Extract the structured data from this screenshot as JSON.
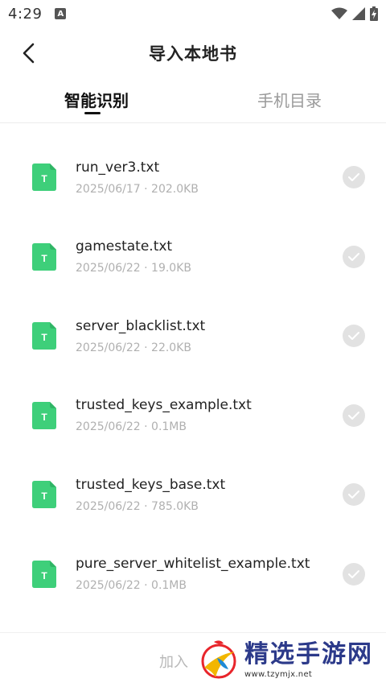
{
  "status_bar": {
    "time": "4:29",
    "notification_badge": "A",
    "icons": [
      "wifi-icon",
      "signal-icon",
      "battery-icon"
    ]
  },
  "header": {
    "title": "导入本地书",
    "back_icon": "chevron-left-icon"
  },
  "tabs": [
    {
      "label": "智能识别",
      "active": true
    },
    {
      "label": "手机目录",
      "active": false
    }
  ],
  "files": [
    {
      "icon_letter": "T",
      "name": "run_ver3.txt",
      "meta": "2025/06/17 · 202.0KB"
    },
    {
      "icon_letter": "T",
      "name": "gamestate.txt",
      "meta": "2025/06/22 · 19.0KB"
    },
    {
      "icon_letter": "T",
      "name": "server_blacklist.txt",
      "meta": "2025/06/22 · 22.0KB"
    },
    {
      "icon_letter": "T",
      "name": "trusted_keys_example.txt",
      "meta": "2025/06/22 · 0.1MB"
    },
    {
      "icon_letter": "T",
      "name": "trusted_keys_base.txt",
      "meta": "2025/06/22 · 785.0KB"
    },
    {
      "icon_letter": "T",
      "name": "pure_server_whitelist_example.txt",
      "meta": "2025/06/22 · 0.1MB"
    }
  ],
  "bottom": {
    "add_label": "加入"
  },
  "watermark": {
    "title": "精选手游网",
    "url": "www.tzymjx.net"
  },
  "colors": {
    "file_icon_green": "#3ecf7a",
    "check_gray": "#e2e2e2",
    "watermark_blue": "#2c3a8a"
  }
}
